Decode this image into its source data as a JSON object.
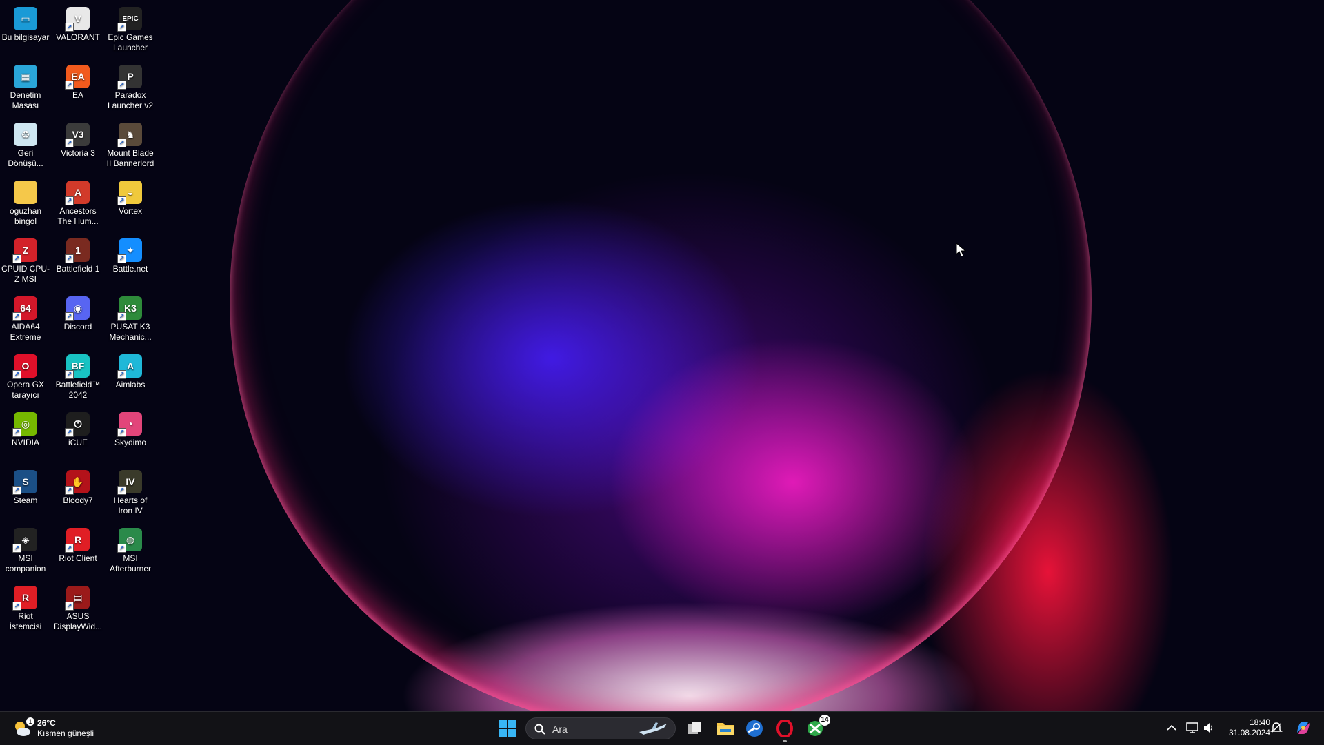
{
  "desktop": {
    "icons": [
      {
        "label": "Bu bilgisayar",
        "icon": "computer-icon",
        "color": "#1a9ad6",
        "glyph": "▭",
        "shortcut": false
      },
      {
        "label": "VALORANT",
        "icon": "valorant-icon",
        "color": "#e8e8e8",
        "glyph": "V",
        "shortcut": true
      },
      {
        "label": "Epic Games Launcher",
        "icon": "epic-games-icon",
        "color": "#222222",
        "glyph": "EPIC",
        "shortcut": true
      },
      {
        "label": "Denetim Masası",
        "icon": "control-panel-icon",
        "color": "#2aa6d9",
        "glyph": "▦",
        "shortcut": false
      },
      {
        "label": "EA",
        "icon": "ea-icon",
        "color": "#f25a1d",
        "glyph": "EA",
        "shortcut": true
      },
      {
        "label": "Paradox Launcher v2",
        "icon": "paradox-icon",
        "color": "#333333",
        "glyph": "P",
        "shortcut": true
      },
      {
        "label": "Geri Dönüşü...",
        "icon": "recycle-bin-icon",
        "color": "#cfe7f2",
        "glyph": "♻",
        "shortcut": false
      },
      {
        "label": "Victoria 3",
        "icon": "victoria-icon",
        "color": "#3b3b3b",
        "glyph": "V3",
        "shortcut": true
      },
      {
        "label": "Mount  Blade II Bannerlord",
        "icon": "bannerlord-icon",
        "color": "#5a4a3a",
        "glyph": "♞",
        "shortcut": true
      },
      {
        "label": "oguzhan bingol",
        "icon": "folder-icon",
        "color": "#f5c84a",
        "glyph": "",
        "shortcut": false
      },
      {
        "label": "Ancestors The Hum...",
        "icon": "ancestors-icon",
        "color": "#d23a2a",
        "glyph": "A",
        "shortcut": true
      },
      {
        "label": "Vortex",
        "icon": "vortex-icon",
        "color": "#f0c93c",
        "glyph": "◒",
        "shortcut": true
      },
      {
        "label": "CPUID CPU-Z MSI",
        "icon": "cpuz-icon",
        "color": "#d3222a",
        "glyph": "Z",
        "shortcut": true
      },
      {
        "label": "Battlefield 1",
        "icon": "battlefield1-icon",
        "color": "#7a2a20",
        "glyph": "1",
        "shortcut": true
      },
      {
        "label": "Battle.net",
        "icon": "battlenet-icon",
        "color": "#148eff",
        "glyph": "✦",
        "shortcut": true
      },
      {
        "label": "AIDA64 Extreme",
        "icon": "aida64-icon",
        "color": "#d4172a",
        "glyph": "64",
        "shortcut": true
      },
      {
        "label": "Discord",
        "icon": "discord-icon",
        "color": "#5865f2",
        "glyph": "◉",
        "shortcut": true
      },
      {
        "label": "PUSAT K3 Mechanic...",
        "icon": "pusat-icon",
        "color": "#2e8b3a",
        "glyph": "K3",
        "shortcut": true
      },
      {
        "label": "Opera GX tarayıcı",
        "icon": "opera-gx-icon",
        "color": "#e0102a",
        "glyph": "O",
        "shortcut": true
      },
      {
        "label": "Battlefield™ 2042",
        "icon": "battlefield2042-icon",
        "color": "#19c3c3",
        "glyph": "BF",
        "shortcut": true
      },
      {
        "label": "Aimlabs",
        "icon": "aimlabs-icon",
        "color": "#1fb8d8",
        "glyph": "A",
        "shortcut": true
      },
      {
        "label": "NVIDIA",
        "icon": "nvidia-icon",
        "color": "#76b900",
        "glyph": "◎",
        "shortcut": true
      },
      {
        "label": "iCUE",
        "icon": "icue-icon",
        "color": "#1e1e1e",
        "glyph": "⏻",
        "shortcut": true
      },
      {
        "label": "Skydimo",
        "icon": "skydimo-icon",
        "color": "#e2457a",
        "glyph": "◔",
        "shortcut": true
      },
      {
        "label": "Steam",
        "icon": "steam-icon",
        "color": "#1b4f86",
        "glyph": "S",
        "shortcut": true
      },
      {
        "label": "Bloody7",
        "icon": "bloody7-icon",
        "color": "#b3121a",
        "glyph": "✋",
        "shortcut": true
      },
      {
        "label": "Hearts of Iron IV",
        "icon": "hoi4-icon",
        "color": "#3a3a2a",
        "glyph": "IV",
        "shortcut": true
      },
      {
        "label": "MSI companion",
        "icon": "msi-companion-icon",
        "color": "#222222",
        "glyph": "◈",
        "shortcut": true
      },
      {
        "label": "Riot Client",
        "icon": "riot-client-icon",
        "color": "#e01e25",
        "glyph": "R",
        "shortcut": true
      },
      {
        "label": "MSI Afterburner",
        "icon": "msi-afterburner-icon",
        "color": "#2a8a4a",
        "glyph": "◍",
        "shortcut": true
      },
      {
        "label": "Riot İstemcisi",
        "icon": "riot-istemcisi-icon",
        "color": "#e01e25",
        "glyph": "R",
        "shortcut": true
      },
      {
        "label": "ASUS DisplayWid...",
        "icon": "asus-displaywidget-icon",
        "color": "#9b1a1a",
        "glyph": "▤",
        "shortcut": true
      }
    ]
  },
  "taskbar": {
    "weather": {
      "temp": "26°C",
      "condition": "Kısmen güneşli",
      "badge": "1"
    },
    "search": {
      "placeholder": "Ara"
    },
    "xbox_badge": "14",
    "clock": {
      "time": "18:40",
      "date": "31.08.2024"
    },
    "colors": {
      "start": "#38b6f5",
      "explorer": "#f7c948",
      "steam": "#1f6fd0",
      "opera": "#e0102a",
      "xbox": "#2fa84a"
    }
  }
}
